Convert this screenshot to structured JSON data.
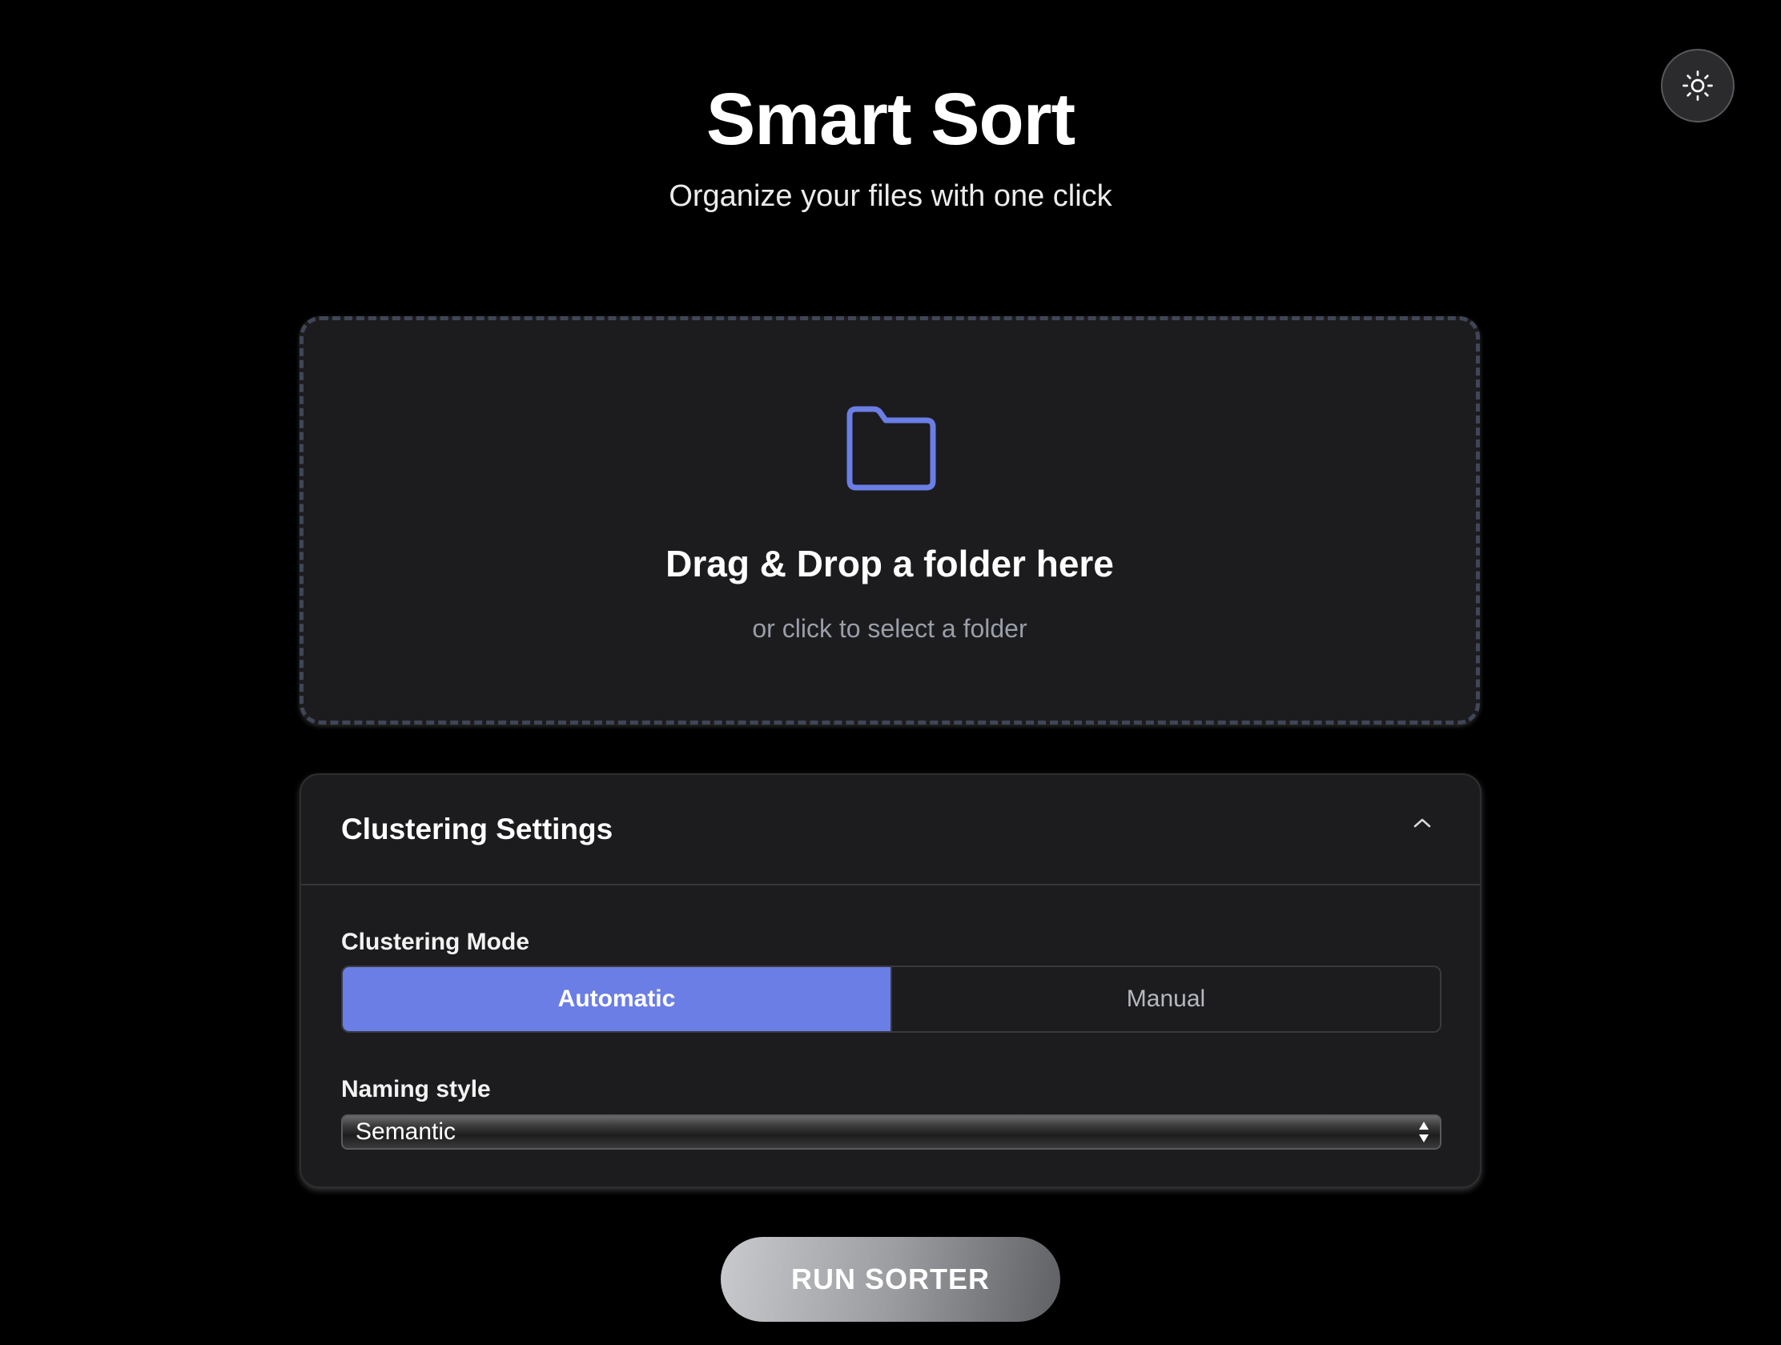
{
  "app": {
    "title": "Smart Sort",
    "subtitle": "Organize your files with one click"
  },
  "theme_toggle": {
    "icon": "sun-icon"
  },
  "dropzone": {
    "icon": "folder-icon",
    "title": "Drag & Drop a folder here",
    "subtitle": "or click to select a folder"
  },
  "settings": {
    "title": "Clustering Settings",
    "expanded": true,
    "clustering_mode": {
      "label": "Clustering Mode",
      "options": [
        "Automatic",
        "Manual"
      ],
      "selected": "Automatic"
    },
    "naming_style": {
      "label": "Naming style",
      "value": "Semantic"
    }
  },
  "run_button": {
    "label": "RUN SORTER"
  },
  "colors": {
    "background": "#000000",
    "panel": "#1c1c1e",
    "accent": "#6b7ee5",
    "muted_text": "#9a9ea8"
  }
}
